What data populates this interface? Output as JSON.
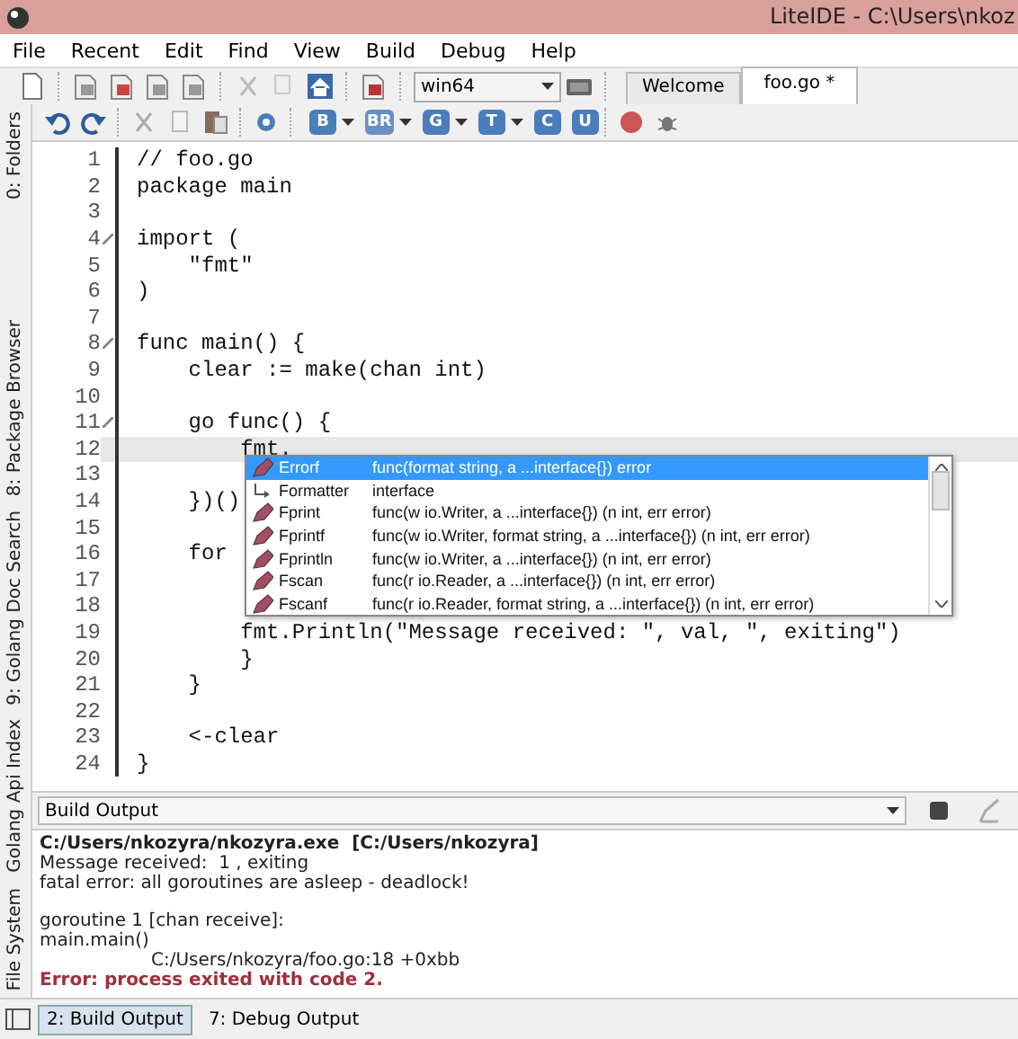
{
  "window": {
    "title": "LiteIDE - C:\\Users\\nkoz"
  },
  "menu": [
    "File",
    "Recent",
    "Edit",
    "Find",
    "View",
    "Build",
    "Debug",
    "Help"
  ],
  "toolbar": {
    "environment": "win64",
    "editor_tabs": [
      {
        "label": "Welcome",
        "selected": false
      },
      {
        "label": "foo.go *",
        "selected": true
      }
    ]
  },
  "build_toolbar": [
    "B",
    "BR",
    "G",
    "T",
    "C",
    "U"
  ],
  "side_tabs": [
    "0: Folders",
    "8: Package Browser",
    "9: Golang Doc Search",
    "Golang Api Index",
    "File System"
  ],
  "editor": {
    "lines": [
      {
        "number": "1",
        "code": "// foo.go",
        "foldable": false,
        "current": false
      },
      {
        "number": "2",
        "code": "package main",
        "foldable": false,
        "current": false
      },
      {
        "number": "3",
        "foldable": false,
        "current": false
      },
      {
        "number": "4",
        "code": "import (",
        "foldable": true,
        "current": false
      },
      {
        "number": "5",
        "code": "    \"fmt\"",
        "foldable": false,
        "current": false
      },
      {
        "number": "6",
        "code": ")",
        "foldable": false,
        "current": false
      },
      {
        "number": "7",
        "foldable": false,
        "current": false
      },
      {
        "number": "8",
        "code": "func main() {",
        "foldable": true,
        "current": false
      },
      {
        "number": "9",
        "code": "    clear := make(chan int)",
        "foldable": false,
        "current": false
      },
      {
        "number": "10",
        "foldable": false,
        "current": false
      },
      {
        "number": "11",
        "code": "    go func() {",
        "foldable": true,
        "current": false
      },
      {
        "number": "12",
        "code": "        fmt.",
        "foldable": false,
        "current": true
      },
      {
        "number": "13",
        "foldable": false,
        "current": false
      },
      {
        "number": "14",
        "code": "    })()",
        "foldable": false,
        "current": false
      },
      {
        "number": "15",
        "foldable": false,
        "current": false
      },
      {
        "number": "16",
        "code": "    for",
        "foldable": false,
        "current": false
      },
      {
        "number": "17",
        "foldable": false,
        "current": false
      },
      {
        "number": "18",
        "foldable": false,
        "current": false
      },
      {
        "number": "19",
        "code": "        fmt.Println(\"Message received: \", val, \", exiting\")",
        "foldable": false,
        "current": false
      },
      {
        "number": "20",
        "code": "        }",
        "foldable": false,
        "current": false
      },
      {
        "number": "21",
        "code": "    }",
        "foldable": false,
        "current": false
      },
      {
        "number": "22",
        "foldable": false,
        "current": false
      },
      {
        "number": "23",
        "code": "    <-clear",
        "foldable": false,
        "current": false
      },
      {
        "number": "24",
        "code": "}",
        "foldable": false,
        "current": false
      }
    ],
    "completions": [
      {
        "name": "Errorf",
        "signature": "func(format string, a ...interface{}) error",
        "kind": "func",
        "selected": true
      },
      {
        "name": "Formatter",
        "signature": "interface",
        "kind": "type",
        "selected": false
      },
      {
        "name": "Fprint",
        "signature": "func(w io.Writer, a ...interface{}) (n int, err error)",
        "kind": "func",
        "selected": false
      },
      {
        "name": "Fprintf",
        "signature": "func(w io.Writer, format string, a ...interface{}) (n int, err error)",
        "kind": "func",
        "selected": false
      },
      {
        "name": "Fprintln",
        "signature": "func(w io.Writer, a ...interface{}) (n int, err error)",
        "kind": "func",
        "selected": false
      },
      {
        "name": "Fscan",
        "signature": "func(r io.Reader, a ...interface{}) (n int, err error)",
        "kind": "func",
        "selected": false
      },
      {
        "name": "Fscanf",
        "signature": "func(r io.Reader, format string, a ...interface{}) (n int, err error)",
        "kind": "func",
        "selected": false
      }
    ]
  },
  "output": {
    "source": "Build Output",
    "lines": [
      {
        "kind": "header",
        "text": "C:/Users/nkozyra/nkozyra.exe  [C:/Users/nkozyra]"
      },
      {
        "kind": "plain",
        "text": "Message received:  1 , exiting"
      },
      {
        "kind": "plain",
        "text": "fatal error: all goroutines are asleep - deadlock!"
      },
      {
        "kind": "blank"
      },
      {
        "kind": "plain",
        "text": "goroutine 1 [chan receive]:"
      },
      {
        "kind": "plain",
        "text": "main.main()"
      },
      {
        "kind": "indent",
        "text": "C:/Users/nkozyra/foo.go:18 +0xbb"
      },
      {
        "kind": "error",
        "text": "Error: process exited with code 2."
      }
    ]
  },
  "bottom_tabs": [
    {
      "label": "2: Build Output",
      "selected": true
    },
    {
      "label": "7: Debug Output",
      "selected": false
    }
  ]
}
